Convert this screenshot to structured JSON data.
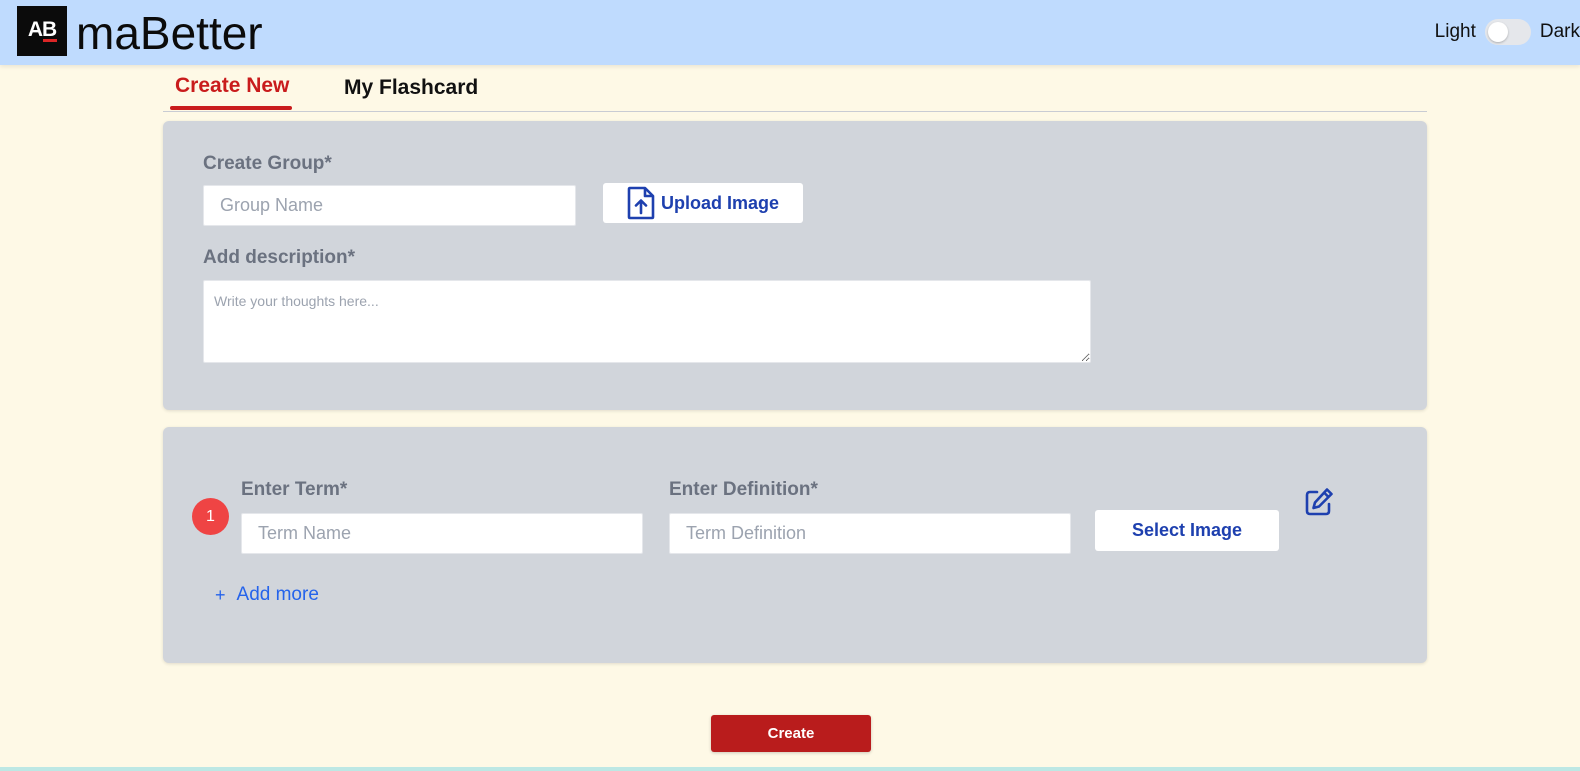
{
  "header": {
    "logo_text": "AB",
    "brand": "maBetter",
    "theme_light": "Light",
    "theme_dark": "Dark"
  },
  "tabs": [
    {
      "label": "Create New",
      "active": true
    },
    {
      "label": "My Flashcard",
      "active": false
    }
  ],
  "group": {
    "label": "Create Group*",
    "name_placeholder": "Group Name",
    "upload_label": "Upload Image",
    "description_label": "Add description*",
    "description_placeholder": "Write your thoughts here..."
  },
  "terms": [
    {
      "number": "1",
      "term_label": "Enter Term*",
      "term_placeholder": "Term Name",
      "definition_label": "Enter Definition*",
      "definition_placeholder": "Term Definition",
      "select_image_label": "Select Image"
    }
  ],
  "add_more_label": "Add more",
  "create_label": "Create",
  "colors": {
    "header_bg": "#bfdbfe",
    "page_bg": "#fef9e6",
    "accent_red": "#c91c1c",
    "link_blue": "#1e40af",
    "card_bg": "#d1d5db"
  }
}
